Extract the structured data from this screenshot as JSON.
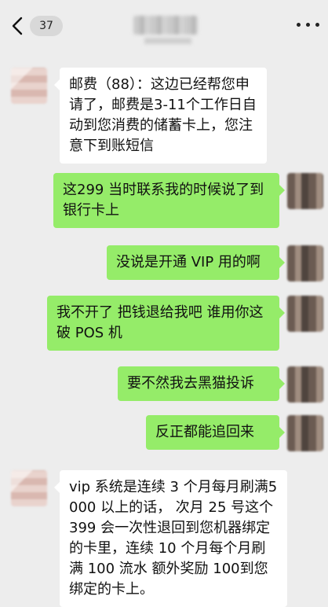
{
  "header": {
    "back_icon": "chevron-left-icon",
    "unread_count": "37",
    "more_icon": "more-dots-icon"
  },
  "messages": [
    {
      "side": "left",
      "text": "邮费（88）：这边已经帮您申请了，邮费是3-11个工作日自动到您消费的储蓄卡上，您注意下到账短信"
    },
    {
      "side": "right",
      "text": "这299 当时联系我的时候说了到银行卡上"
    },
    {
      "side": "right",
      "text": "没说是开通 VIP 用的啊"
    },
    {
      "side": "right",
      "text": "我不开了 把钱退给我吧 谁用你这破 POS 机"
    },
    {
      "side": "right",
      "text": "要不然我去黑猫投诉"
    },
    {
      "side": "right",
      "text": "反正都能追回来"
    },
    {
      "side": "left",
      "text": "vip 系统是连续 3 个月每月刷满5000 以上的话， 次月 25 号这个 399 会一次性退回到您机器绑定的卡里，连续 10 个月每个月刷满 100 流水 额外奖励 100到您绑定的卡上。"
    }
  ],
  "colors": {
    "background": "#ededed",
    "sent_bubble": "#95ec69",
    "received_bubble": "#ffffff"
  }
}
